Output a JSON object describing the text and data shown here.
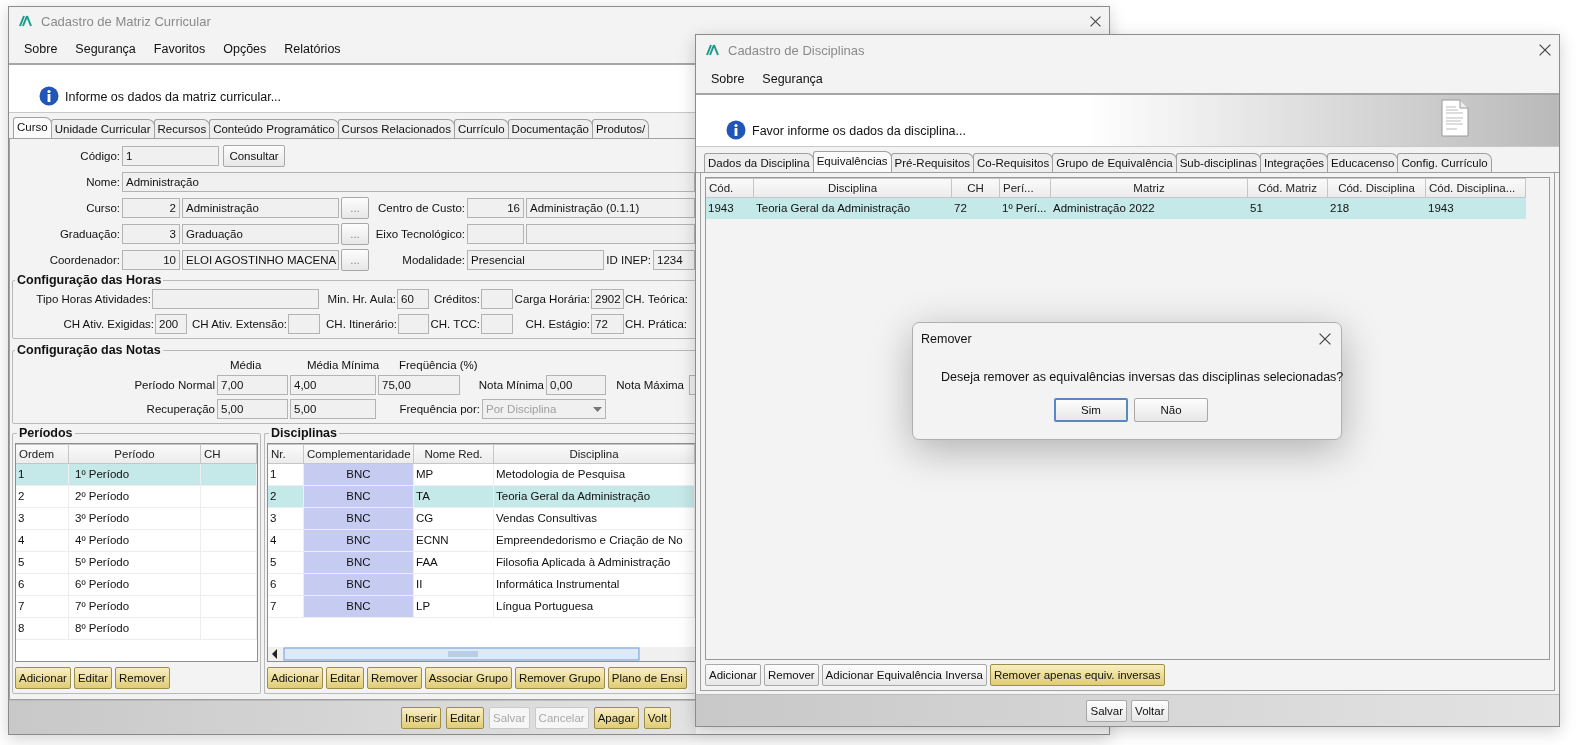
{
  "main_window": {
    "title": "Cadastro de Matriz Curricular",
    "menu": [
      "Sobre",
      "Segurança",
      "Favoritos",
      "Opções",
      "Relatórios"
    ],
    "info": "Informe os dados da matriz curricular...",
    "tabs": [
      {
        "label": "Curso",
        "selected": true
      },
      {
        "label": "Unidade Curricular",
        "selected": false
      },
      {
        "label": "Recursos",
        "selected": false
      },
      {
        "label": "Conteúdo Programático",
        "selected": false
      },
      {
        "label": "Cursos Relacionados",
        "selected": false
      },
      {
        "label": "Currículo",
        "selected": false
      },
      {
        "label": "Documentação",
        "selected": false
      },
      {
        "label": "Produtos/",
        "selected": false
      }
    ],
    "codigo": {
      "label": "Código:",
      "value": "1",
      "button": "Consultar"
    },
    "nome": {
      "label": "Nome:",
      "value": "Administração"
    },
    "lookups": [
      {
        "label": "Curso:",
        "code": "2",
        "value": "Administração",
        "button": "...",
        "side": {
          "label": "Centro de Custo:",
          "code": "16",
          "value": "Administração (0.1.1)"
        }
      },
      {
        "label": "Graduação:",
        "code": "3",
        "value": "Graduação",
        "button": "...",
        "side": {
          "label": "Eixo Tecnológico:"
        }
      },
      {
        "label": "Coordenador:",
        "code": "10",
        "value": "ELOI AGOSTINHO MACENA",
        "button": "...",
        "modalidade": {
          "label": "Modalidade:",
          "value": "Presencial"
        },
        "id_inep": {
          "label": "ID INEP:",
          "value": "1234"
        }
      }
    ],
    "horas": {
      "title": "Configuração das Horas",
      "rows": [
        [
          {
            "label": "Tipo Horas Atividades:"
          },
          null,
          {
            "label": "Min. Hr. Aula:",
            "value": "60"
          },
          {
            "label": "Créditos:"
          },
          {
            "label": "Carga Horária:",
            "value": "2902"
          },
          {
            "label": "CH. Teórica:"
          }
        ],
        [
          {
            "label": "CH Ativ. Exigidas:",
            "value": "200"
          },
          {
            "label": "CH Ativ. Extensão:"
          },
          {
            "label": "CH. Itinerário:"
          },
          {
            "label": "CH. TCC:"
          },
          {
            "label": "CH. Estágio:",
            "value": "72"
          },
          {
            "label": "CH. Prática:"
          }
        ]
      ]
    },
    "notas": {
      "title": "Configuração das Notas",
      "headers": [
        "Média",
        "Média Mínima",
        "Freqüência (%)"
      ],
      "normal": {
        "label": "Período Normal",
        "values": [
          "7,00",
          "4,00",
          "75,00"
        ]
      },
      "nota_minima": {
        "label": "Nota Mínima",
        "value": "0,00"
      },
      "nota_maxima": {
        "label": "Nota Máxima"
      },
      "recuperacao": {
        "label": "Recuperação",
        "values": [
          "5,00",
          "5,00"
        ]
      },
      "frequencia_por": {
        "label": "Frequência por:",
        "value": "Por Disciplina",
        "disabled": true
      }
    },
    "periodos": {
      "title": "Períodos",
      "columns": [
        "Ordem",
        "Período",
        "CH"
      ],
      "rows": [
        {
          "ordem": "1",
          "periodo": "1º Período",
          "selected": true
        },
        {
          "ordem": "2",
          "periodo": "2º Período",
          "selected": false
        },
        {
          "ordem": "3",
          "periodo": "3º Período",
          "selected": false
        },
        {
          "ordem": "4",
          "periodo": "4º Período",
          "selected": false
        },
        {
          "ordem": "5",
          "periodo": "5º Período",
          "selected": false
        },
        {
          "ordem": "6",
          "periodo": "6º Período",
          "selected": false
        },
        {
          "ordem": "7",
          "periodo": "7º Período",
          "selected": false
        },
        {
          "ordem": "8",
          "periodo": "8º Período",
          "selected": false
        }
      ],
      "buttons": [
        "Adicionar",
        "Editar",
        "Remover"
      ]
    },
    "disciplinas": {
      "title": "Disciplinas",
      "columns": [
        "Nr.",
        "Complementaridade",
        "Nome Red.",
        "Disciplina"
      ],
      "rows": [
        {
          "nr": "1",
          "comp": "BNC",
          "nome": "MP",
          "disciplina": "Metodologia de Pesquisa",
          "selected": false
        },
        {
          "nr": "2",
          "comp": "BNC",
          "nome": "TA",
          "disciplina": "Teoria Geral da Administração",
          "selected": true
        },
        {
          "nr": "3",
          "comp": "BNC",
          "nome": "CG",
          "disciplina": "Vendas Consultivas",
          "selected": false
        },
        {
          "nr": "4",
          "comp": "BNC",
          "nome": "ECNN",
          "disciplina": "Empreendedorismo e Criação de No",
          "selected": false
        },
        {
          "nr": "5",
          "comp": "BNC",
          "nome": "FAA",
          "disciplina": "Filosofia Aplicada à Administração",
          "selected": false
        },
        {
          "nr": "6",
          "comp": "BNC",
          "nome": "II",
          "disciplina": "Informática Instrumental",
          "selected": false
        },
        {
          "nr": "7",
          "comp": "BNC",
          "nome": "LP",
          "disciplina": "Língua Portuguesa",
          "selected": false
        }
      ],
      "buttons": [
        "Adicionar",
        "Editar",
        "Remover",
        "Associar Grupo",
        "Remover Grupo",
        "Plano de Ensi"
      ]
    },
    "bottom_buttons": [
      {
        "label": "Inserir",
        "disabled": false
      },
      {
        "label": "Editar",
        "disabled": false
      },
      {
        "label": "Salvar",
        "disabled": true
      },
      {
        "label": "Cancelar",
        "disabled": true
      },
      {
        "label": "Apagar",
        "disabled": false
      },
      {
        "label": "Volt",
        "disabled": false
      }
    ]
  },
  "disciplinas_window": {
    "title": "Cadastro de Disciplinas",
    "menu": [
      "Sobre",
      "Segurança"
    ],
    "info": "Favor informe os dados da disciplina...",
    "tabs": [
      {
        "label": "Dados da Disciplina",
        "selected": false
      },
      {
        "label": "Equivalências",
        "selected": true
      },
      {
        "label": "Pré-Requisitos",
        "selected": false
      },
      {
        "label": "Co-Requisitos",
        "selected": false
      },
      {
        "label": "Grupo de Equivalência",
        "selected": false
      },
      {
        "label": "Sub-disciplinas",
        "selected": false
      },
      {
        "label": "Integrações",
        "selected": false
      },
      {
        "label": "Educacenso",
        "selected": false
      },
      {
        "label": "Config. Currículo",
        "selected": false
      }
    ],
    "columns": [
      "Cód.",
      "Disciplina",
      "CH",
      "Perí...",
      "Matriz",
      "Cód. Matriz",
      "Cód. Disciplina",
      "Cód. Disciplina..."
    ],
    "rows": [
      {
        "cells": [
          "1943",
          "Teoria Geral da Administração",
          "72",
          "1º Perí...",
          "Administração 2022",
          "51",
          "218",
          "1943"
        ],
        "selected": true
      }
    ],
    "buttons": [
      {
        "label": "Adicionar",
        "kind": "plain"
      },
      {
        "label": "Remover",
        "kind": "plain"
      },
      {
        "label": "Adicionar Equivalência Inversa",
        "kind": "plain"
      },
      {
        "label": "Remover apenas equiv. inversas",
        "kind": "gold"
      }
    ],
    "bottom_buttons": [
      "Salvar",
      "Voltar"
    ]
  },
  "dialog": {
    "title": "Remover",
    "message": "Deseja remover as equivalências inversas das disciplinas selecionadas?",
    "buttons": [
      {
        "label": "Sim",
        "focused": true
      },
      {
        "label": "Não",
        "focused": false
      }
    ]
  }
}
